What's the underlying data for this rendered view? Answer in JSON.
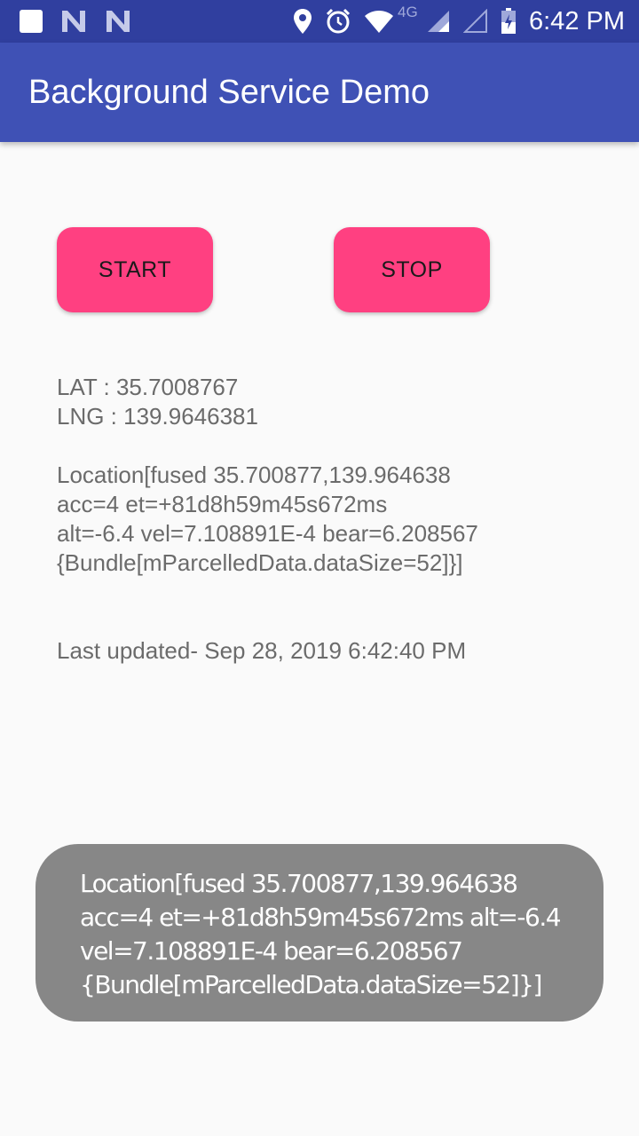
{
  "status_bar": {
    "time": "6:42 PM",
    "network_type": "4G",
    "icons": [
      "app-notification-icon",
      "n-icon",
      "n-icon",
      "location-icon",
      "alarm-icon",
      "wifi-icon",
      "signal-icon",
      "signal-empty-icon",
      "battery-icon"
    ]
  },
  "app_bar": {
    "title": "Background Service Demo"
  },
  "buttons": {
    "start_label": "START",
    "stop_label": "STOP"
  },
  "coords": {
    "lat": "LAT :  35.7008767",
    "lng": "LNG : 139.9646381"
  },
  "location_lines": [
    "Location[fused 35.700877,139.964638",
    "acc=4 et=+81d8h59m45s672ms",
    "alt=-6.4 vel=7.108891E-4 bear=6.208567",
    "{Bundle[mParcelledData.dataSize=52]}]"
  ],
  "last_updated": "Last updated- Sep 28, 2019 6:42:40 PM",
  "toast": {
    "lines": [
      "Location[fused 35.700877,139.964638",
      "acc=4 et=+81d8h59m45s672ms alt=-6.4",
      "vel=7.108891E-4 bear=6.208567",
      "{Bundle[mParcelledData.dataSize=52]}]"
    ]
  },
  "colors": {
    "status_bar": "#303f9f",
    "app_bar": "#3f51b5",
    "accent": "#ff4081",
    "toast": "#878787"
  }
}
